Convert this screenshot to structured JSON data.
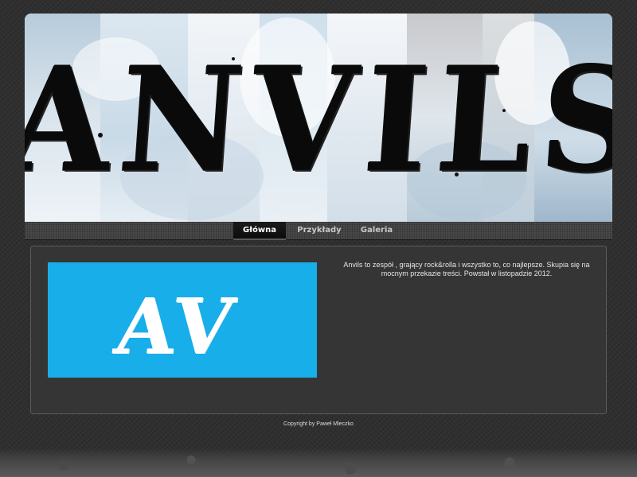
{
  "header": {
    "logo_text": "ANVILS"
  },
  "nav": {
    "items": [
      {
        "label": "Główna",
        "active": true
      },
      {
        "label": "Przykłady",
        "active": false
      },
      {
        "label": "Galeria",
        "active": false
      }
    ]
  },
  "content": {
    "image_text": "AV",
    "image_bg_color": "#17aee9",
    "description": "Anvils to zespół , grający rock&rolla i wszystko to, co najlepsze. Skupia się na mocnym przekazie treści. Powstał w listopadzie 2012."
  },
  "footer": {
    "copyright": "Copyright by Paweł Mleczko"
  },
  "colors": {
    "page_bg": "#2d2d2d",
    "content_bg": "#353535",
    "nav_active": "#0c0c0c"
  }
}
